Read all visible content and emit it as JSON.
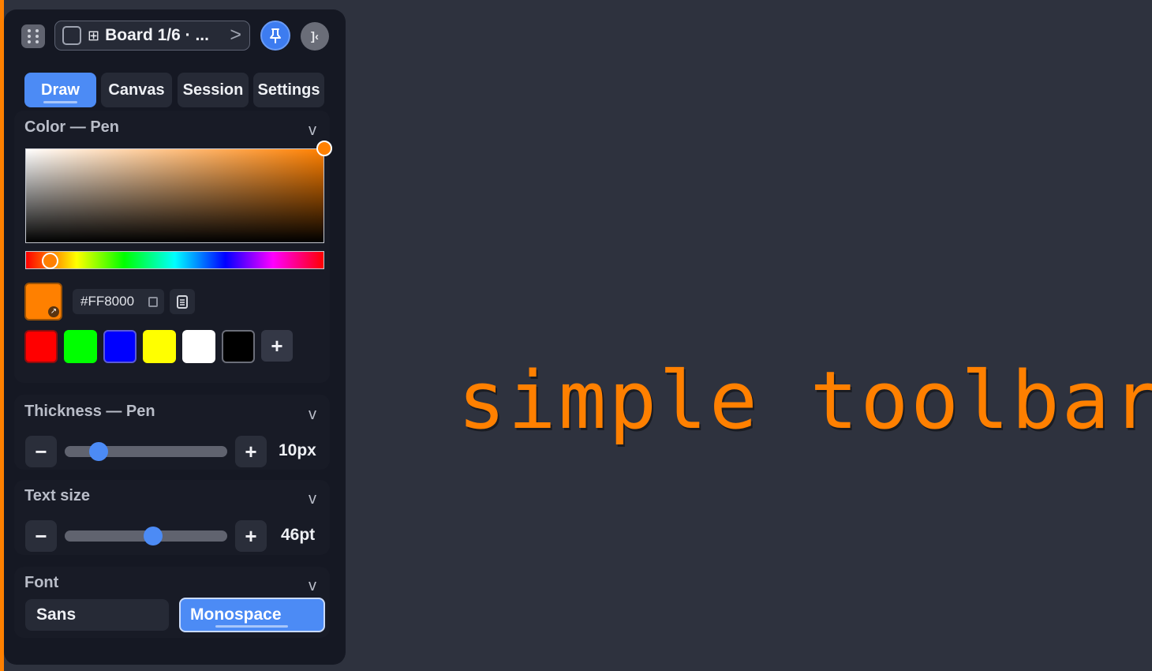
{
  "header": {
    "board_label": "Board 1/6 · ...",
    "board_next_glyph": ">",
    "grid_glyph": "⊞",
    "collapse_glyph": "]‹"
  },
  "tabs": [
    {
      "label": "Draw",
      "active": true
    },
    {
      "label": "Canvas",
      "active": false
    },
    {
      "label": "Session",
      "active": false
    },
    {
      "label": "Settings",
      "active": false
    }
  ],
  "color": {
    "title": "Color — Pen",
    "chevron": "v",
    "hex_value": "#FF8000",
    "current_color": "#FF8000",
    "swatches": [
      "#FF0000",
      "#00FF00",
      "#0000FF",
      "#FFFF00",
      "#FFFFFF",
      "#000000"
    ],
    "add_glyph": "+",
    "corner_glyph": "↗"
  },
  "thickness": {
    "title": "Thickness — Pen",
    "chevron": "v",
    "value": "10px",
    "minus": "−",
    "plus": "+",
    "level": 0.17
  },
  "text_size": {
    "title": "Text size",
    "chevron": "v",
    "value": "46pt",
    "minus": "−",
    "plus": "+",
    "level": 0.55
  },
  "font": {
    "title": "Font",
    "chevron": "v",
    "options": [
      {
        "label": "Sans",
        "active": false
      },
      {
        "label": "Monospace",
        "active": true
      }
    ]
  },
  "canvas": {
    "text": "simple toolbar",
    "text_color": "#FF8000"
  },
  "colors": {
    "accent": "#4C8BF5",
    "panel": "#151823",
    "background": "#2E323E"
  }
}
